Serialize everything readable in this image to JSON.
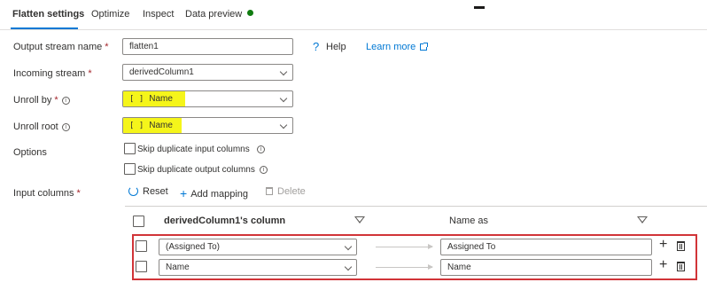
{
  "tabs": [
    {
      "label": "Flatten settings",
      "active": true
    },
    {
      "label": "Optimize"
    },
    {
      "label": "Inspect"
    },
    {
      "label": "Data preview",
      "status_color": "#107c10"
    }
  ],
  "colors": {
    "accent": "#0078d4",
    "highlight": "#f5f51a",
    "outline": "#d13438"
  },
  "form": {
    "output_stream": {
      "label": "Output stream name",
      "required": "*",
      "value": "flatten1"
    },
    "help": {
      "icon": "?",
      "label": "Help"
    },
    "learn_more": {
      "label": "Learn more",
      "icon": "external-link-icon"
    },
    "incoming_stream": {
      "label": "Incoming stream",
      "required": "*",
      "value": "derivedColumn1"
    },
    "unroll_by": {
      "label": "Unroll by",
      "required": "*",
      "info": "ⓘ",
      "icon": "[ ]",
      "value": "Name"
    },
    "unroll_root": {
      "label": "Unroll root",
      "info": "ⓘ",
      "icon": "[ ]",
      "value": "Name"
    },
    "options": {
      "label": "Options",
      "skip_input": {
        "label": "Skip duplicate input columns",
        "checked": false
      },
      "skip_output": {
        "label": "Skip duplicate output columns",
        "checked": false
      }
    },
    "input_columns": {
      "label": "Input columns",
      "required": "*"
    }
  },
  "toolbar": {
    "reset": "Reset",
    "add_mapping": "Add mapping",
    "delete": "Delete"
  },
  "grid": {
    "headers": {
      "source": "derivedColumn1's column",
      "target": "Name as"
    },
    "rows": [
      {
        "source": "(Assigned To)",
        "target": "Assigned To"
      },
      {
        "source": "Name",
        "target": "Name"
      }
    ]
  }
}
